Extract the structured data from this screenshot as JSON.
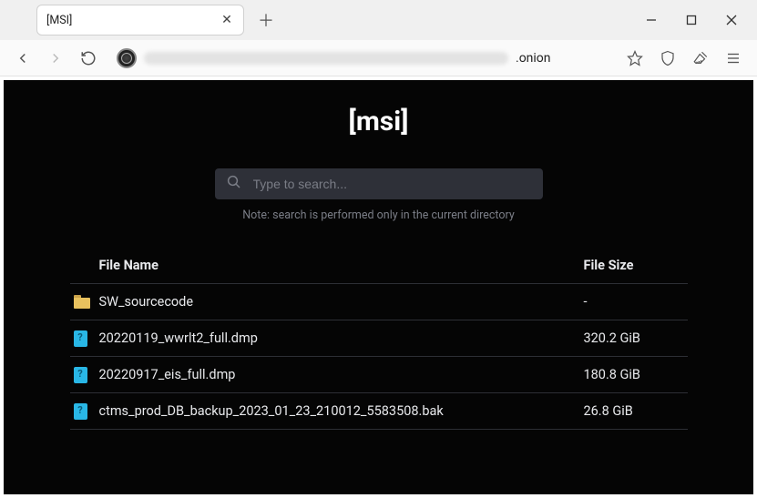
{
  "tab": {
    "title": "[MSI]"
  },
  "url": {
    "suffix": ".onion"
  },
  "page": {
    "title": "[msi]",
    "search_placeholder": "Type to search...",
    "search_note": "Note: search is performed only in the current directory"
  },
  "table": {
    "head_name": "File Name",
    "head_size": "File Size",
    "rows": [
      {
        "icon": "folder",
        "name": "SW_sourcecode",
        "size": "-"
      },
      {
        "icon": "file",
        "name": "20220119_wwrlt2_full.dmp",
        "size": "320.2 GiB"
      },
      {
        "icon": "file",
        "name": "20220917_eis_full.dmp",
        "size": "180.8 GiB"
      },
      {
        "icon": "file",
        "name": "ctms_prod_DB_backup_2023_01_23_210012_5583508.bak",
        "size": "26.8 GiB"
      }
    ]
  }
}
